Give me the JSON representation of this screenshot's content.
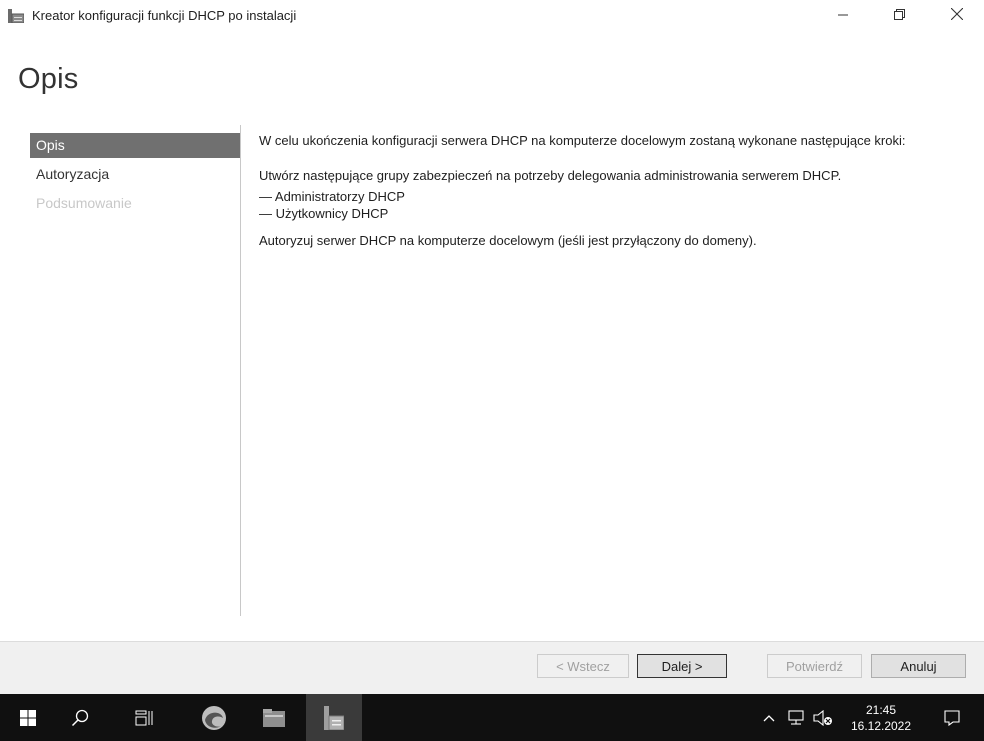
{
  "window": {
    "title": "Kreator konfiguracji funkcji DHCP po instalacji"
  },
  "header": {
    "title": "Opis"
  },
  "nav": {
    "items": [
      {
        "label": "Opis",
        "state": "selected"
      },
      {
        "label": "Autoryzacja",
        "state": "normal"
      },
      {
        "label": "Podsumowanie",
        "state": "disabled"
      }
    ]
  },
  "content": {
    "intro": "W celu ukończenia konfiguracji serwera DHCP na komputerze docelowym zostaną wykonane następujące kroki:",
    "groups_heading": "Utwórz następujące grupy zabezpieczeń na potrzeby delegowania administrowania serwerem DHCP.",
    "groups": [
      "— Administratorzy DHCP",
      "— Użytkownicy DHCP"
    ],
    "authorize": "Autoryzuj serwer DHCP na komputerze docelowym (jeśli jest przyłączony do domeny)."
  },
  "buttons": {
    "back": "< Wstecz",
    "next": "Dalej >",
    "confirm": "Potwierdź",
    "cancel": "Anuluj"
  },
  "taskbar": {
    "time": "21:45",
    "date": "16.12.2022",
    "icons": [
      "windows-start-icon",
      "search-icon",
      "task-view-icon",
      "edge-icon",
      "file-explorer-icon",
      "server-manager-icon"
    ],
    "tray_icons": [
      "chevron-up-icon",
      "network-icon",
      "volume-muted-icon",
      "notification-icon"
    ]
  },
  "colors": {
    "nav_selected_bg": "#707070",
    "taskbar_bg": "#101010",
    "button_bar_bg": "#f0f0f0"
  }
}
